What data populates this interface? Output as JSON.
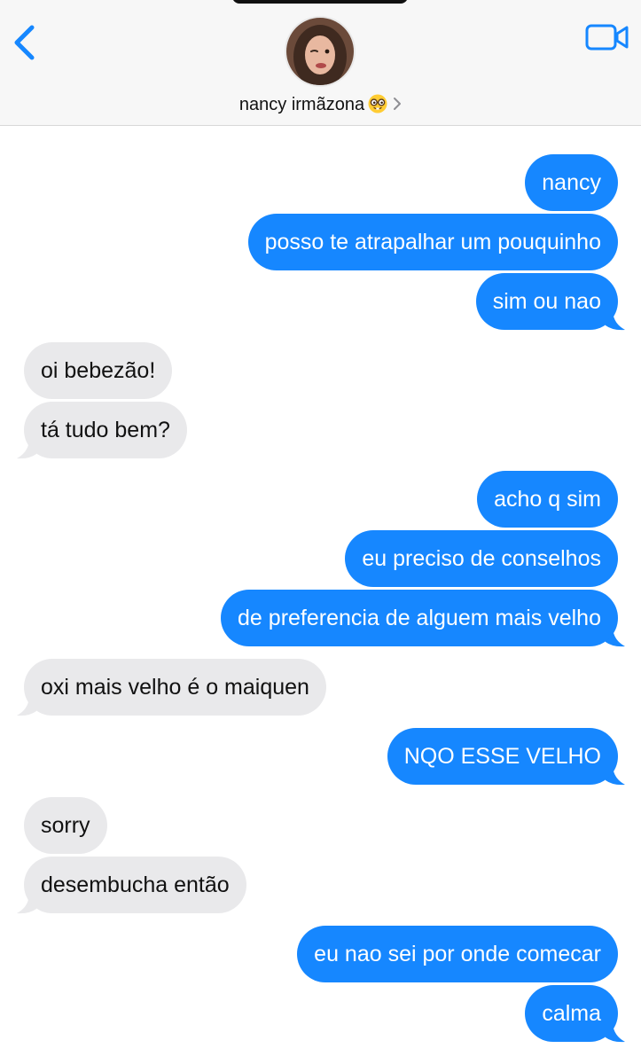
{
  "header": {
    "contact_name": "nancy irmãzona",
    "contact_emoji": "nerd-face-emoji",
    "back_icon": "chevron-left-icon",
    "video_icon": "video-camera-icon",
    "disclosure_icon": "chevron-right-icon",
    "avatar_icon": "contact-avatar-photo"
  },
  "colors": {
    "sent_bubble": "#1687ff",
    "received_bubble": "#e9e9eb",
    "accent": "#1687ff",
    "header_bg": "#f7f7f7"
  },
  "messages": [
    {
      "from": "me",
      "text": "nancy"
    },
    {
      "from": "me",
      "text": "posso te atrapalhar um pouquinho"
    },
    {
      "from": "me",
      "text": "sim ou nao"
    },
    {
      "from": "them",
      "text": "oi bebezão!"
    },
    {
      "from": "them",
      "text": "tá tudo bem?"
    },
    {
      "from": "me",
      "text": "acho q sim"
    },
    {
      "from": "me",
      "text": "eu preciso de conselhos"
    },
    {
      "from": "me",
      "text": "de preferencia de alguem mais velho"
    },
    {
      "from": "them",
      "text": "oxi mais velho é o maiquen"
    },
    {
      "from": "me",
      "text": "NQO ESSE VELHO"
    },
    {
      "from": "them",
      "text": "sorry"
    },
    {
      "from": "them",
      "text": "desembucha então"
    },
    {
      "from": "me",
      "text": "eu nao sei por onde comecar"
    },
    {
      "from": "me",
      "text": "calma"
    }
  ]
}
